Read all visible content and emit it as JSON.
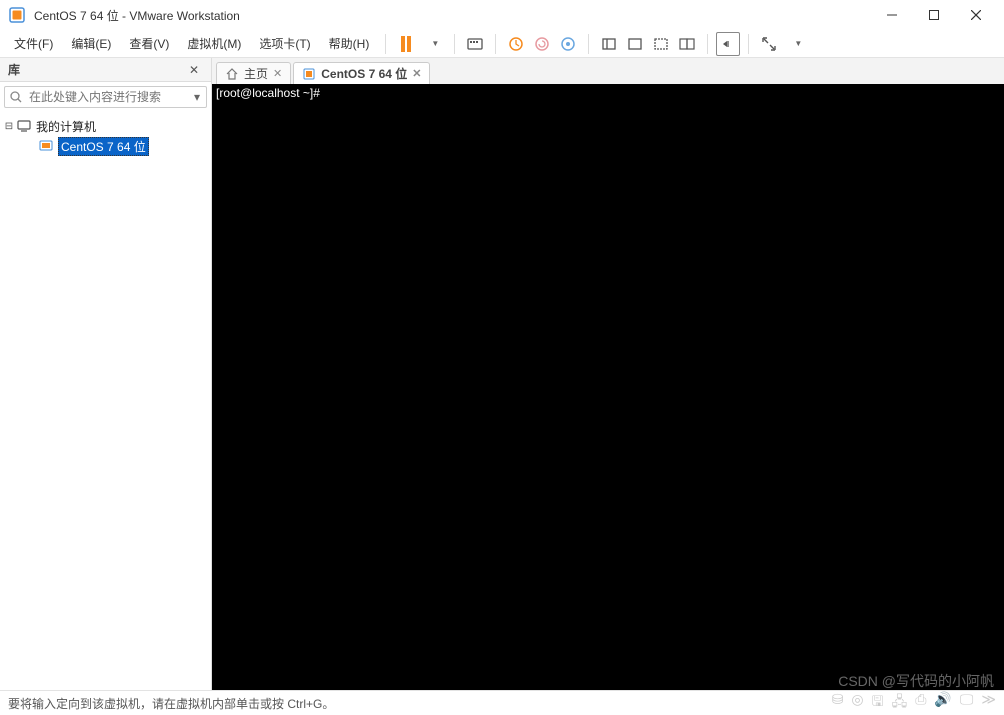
{
  "window": {
    "title": "CentOS 7 64 位 - VMware Workstation"
  },
  "menu": {
    "file": "文件(F)",
    "edit": "编辑(E)",
    "view": "查看(V)",
    "vm": "虚拟机(M)",
    "tabs": "选项卡(T)",
    "help": "帮助(H)"
  },
  "sidebar": {
    "title": "库",
    "search_placeholder": "在此处键入内容进行搜索",
    "root_label": "我的计算机",
    "vm_label": "CentOS 7 64 位"
  },
  "tabs": {
    "home": "主页",
    "vm": "CentOS 7 64 位"
  },
  "terminal": {
    "line1": "[root@localhost ~]#"
  },
  "statusbar": {
    "message": "要将输入定向到该虚拟机，请在虚拟机内部单击或按 Ctrl+G。"
  },
  "watermark": "CSDN @写代码的小阿帆"
}
